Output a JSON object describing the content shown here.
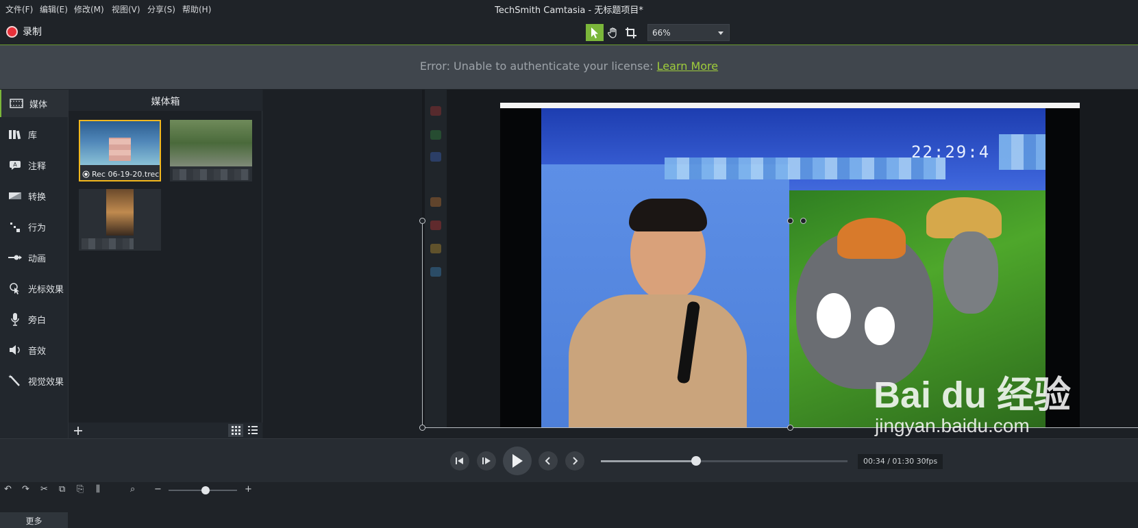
{
  "menu": {
    "items": [
      "文件(F)",
      "编辑(E)",
      "修改(M)",
      "视图(V)",
      "分享(S)",
      "帮助(H)"
    ],
    "app_title": "TechSmith Camtasia - 无标题项目*"
  },
  "toolbar": {
    "record_label": "录制",
    "zoom_value": "66%"
  },
  "error_banner": {
    "message": "Error: Unable to authenticate your license:",
    "link": "Learn More"
  },
  "sidebar": {
    "items": [
      {
        "label": "媒体",
        "icon": "film-icon"
      },
      {
        "label": "库",
        "icon": "library-icon"
      },
      {
        "label": "注释",
        "icon": "annotation-icon"
      },
      {
        "label": "转换",
        "icon": "transition-icon"
      },
      {
        "label": "行为",
        "icon": "behavior-icon"
      },
      {
        "label": "动画",
        "icon": "animation-icon"
      },
      {
        "label": "光标效果",
        "icon": "cursor-effect-icon"
      },
      {
        "label": "旁白",
        "icon": "microphone-icon"
      },
      {
        "label": "音效",
        "icon": "speaker-icon"
      },
      {
        "label": "视觉效果",
        "icon": "magic-wand-icon"
      }
    ],
    "more_label": "更多"
  },
  "media_bin": {
    "title": "媒体箱",
    "clip1_label": "Rec 06-19-20.trec"
  },
  "preview": {
    "timestamp": "22:29:4"
  },
  "playback": {
    "timecode": "00:34 / 01:30 30fps"
  },
  "watermark": {
    "logo": "Bai du 经验",
    "url": "jingyan.baidu.com"
  },
  "colors": {
    "accent": "#7bb63a",
    "record": "#e8313a",
    "link": "#9fcd3b",
    "selected_thumb": "#f2b81e"
  }
}
